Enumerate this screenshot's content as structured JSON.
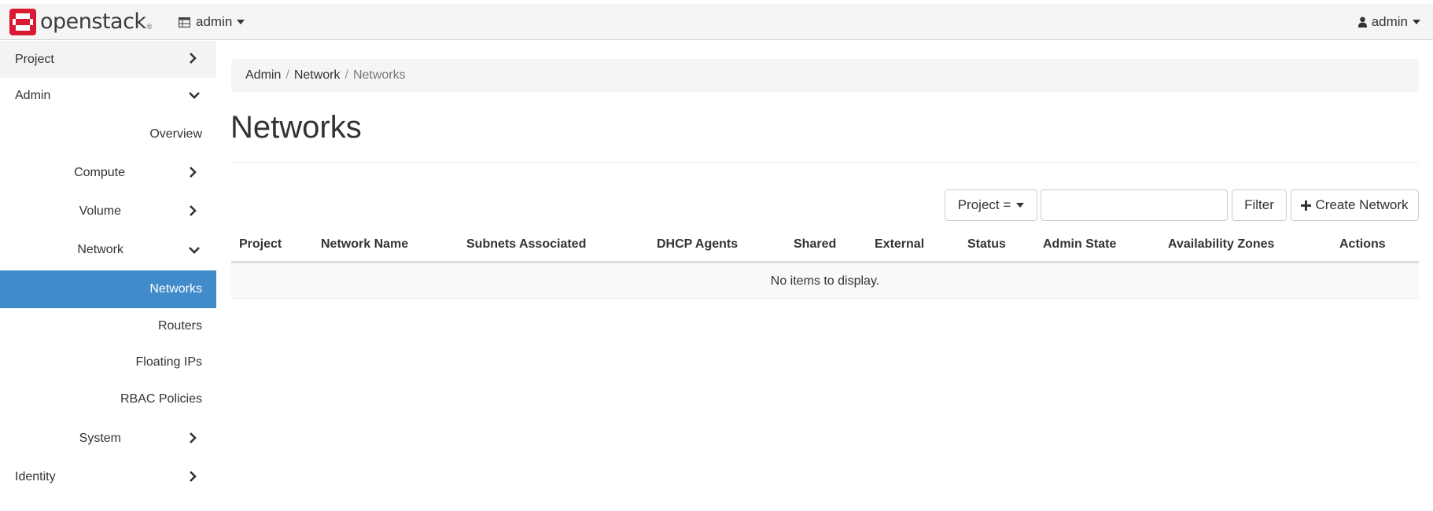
{
  "navbar": {
    "brand": "openstack",
    "brand_mark": "®",
    "project_label": "admin",
    "user_label": "admin"
  },
  "sidebar": {
    "project": "Project",
    "admin": "Admin",
    "items": [
      {
        "label": "Overview"
      },
      {
        "label": "Compute"
      },
      {
        "label": "Volume"
      },
      {
        "label": "Network"
      },
      {
        "label": "Networks"
      },
      {
        "label": "Routers"
      },
      {
        "label": "Floating IPs"
      },
      {
        "label": "RBAC Policies"
      },
      {
        "label": "System"
      }
    ],
    "identity": "Identity"
  },
  "breadcrumb": {
    "items": [
      "Admin",
      "Network",
      "Networks"
    ],
    "separator": "/"
  },
  "page": {
    "title": "Networks"
  },
  "toolbar": {
    "filter_field": "Project =",
    "filter_value": "",
    "filter_button": "Filter",
    "create_button": "Create Network"
  },
  "table": {
    "columns": [
      "Project",
      "Network Name",
      "Subnets Associated",
      "DHCP Agents",
      "Shared",
      "External",
      "Status",
      "Admin State",
      "Availability Zones",
      "Actions"
    ],
    "empty_message": "No items to display."
  },
  "colors": {
    "brand_red": "#da1a32",
    "active_blue": "#428bca"
  },
  "icons": {
    "logo": "openstack-logo-icon",
    "project_switcher": "table-icon",
    "user": "user-icon",
    "expand": "chevron-right-icon",
    "collapse": "chevron-down-icon",
    "create": "plus-icon"
  }
}
